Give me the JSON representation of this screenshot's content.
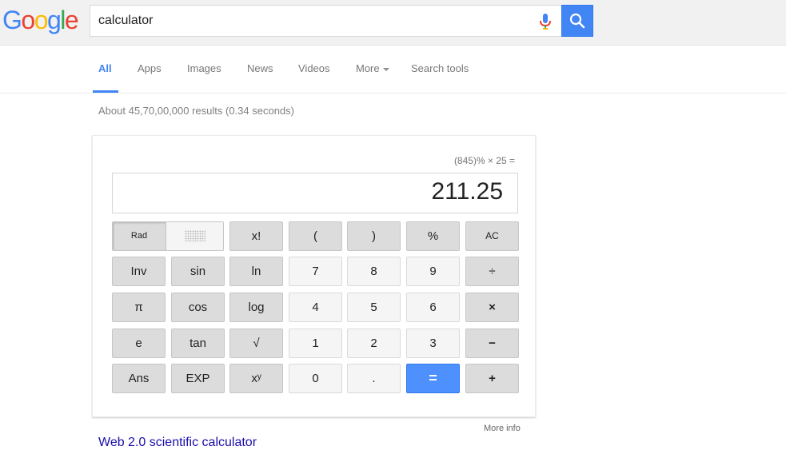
{
  "logo": {
    "letters": [
      "G",
      "o",
      "o",
      "g",
      "l",
      "e"
    ],
    "colors": [
      "#4285f4",
      "#ea4335",
      "#fbbc05",
      "#4285f4",
      "#34a853",
      "#ea4335"
    ]
  },
  "search": {
    "value": "calculator",
    "placeholder": ""
  },
  "tabs": [
    "All",
    "Apps",
    "Images",
    "News",
    "Videos",
    "More",
    "Search tools"
  ],
  "result_stats": "About 45,70,00,000 results (0.34 seconds)",
  "calculator": {
    "history": "(845)% × 25 =",
    "display": "211.25",
    "mode_label": "Rad",
    "keys": {
      "fact": "x!",
      "lparen": "(",
      "rparen": ")",
      "percent": "%",
      "clear": "AC",
      "inv": "Inv",
      "sin": "sin",
      "ln": "ln",
      "k7": "7",
      "k8": "8",
      "k9": "9",
      "divide": "÷",
      "pi": "π",
      "cos": "cos",
      "log": "log",
      "k4": "4",
      "k5": "5",
      "k6": "6",
      "multiply": "×",
      "e": "e",
      "tan": "tan",
      "sqrt": "√",
      "k1": "1",
      "k2": "2",
      "k3": "3",
      "minus": "−",
      "ans": "Ans",
      "exp": "EXP",
      "pow": "xʸ",
      "k0": "0",
      "dot": ".",
      "equals": "=",
      "plus": "+"
    }
  },
  "more_info": "More info",
  "next_result_partial": "Web 2.0 scientific calculator"
}
